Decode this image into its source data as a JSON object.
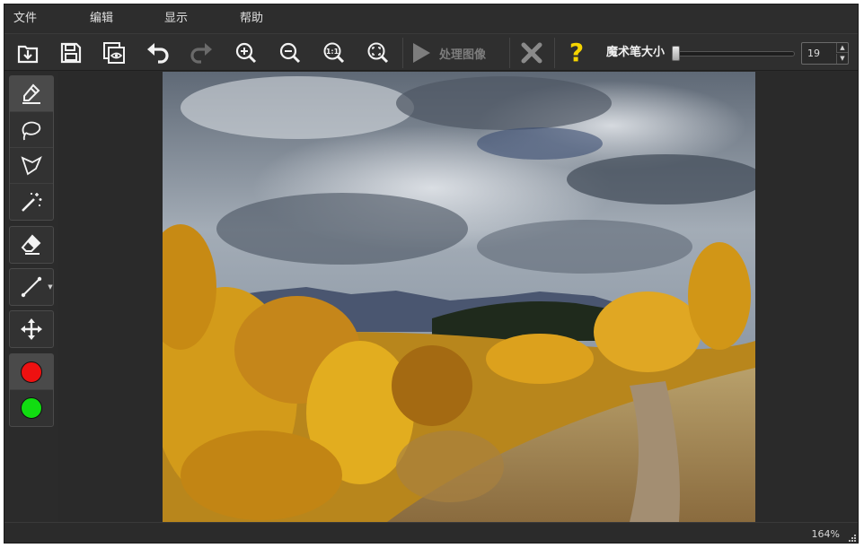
{
  "menu": {
    "items": [
      {
        "label": "文件"
      },
      {
        "label": "编辑"
      },
      {
        "label": "显示"
      },
      {
        "label": "帮助"
      }
    ]
  },
  "toolbar": {
    "buttons": [
      {
        "icon": "import-icon"
      },
      {
        "icon": "save-icon"
      },
      {
        "icon": "preview-icon"
      },
      {
        "icon": "undo-icon"
      },
      {
        "icon": "redo-icon"
      },
      {
        "icon": "zoom-in-icon"
      },
      {
        "icon": "zoom-out-icon"
      },
      {
        "icon": "actual-size-icon",
        "text": "1:1"
      },
      {
        "icon": "fit-to-window-icon"
      }
    ],
    "process_label": "处理图像",
    "help_glyph": "?",
    "brush_size_label": "魔术笔大小",
    "brush_size_value": "19"
  },
  "tools": [
    {
      "icon": "marker-icon",
      "active": true
    },
    {
      "icon": "lasso-icon"
    },
    {
      "icon": "polygon-lasso-icon"
    },
    {
      "icon": "magic-wand-icon"
    },
    {
      "icon": "eraser-icon"
    },
    {
      "icon": "line-icon"
    },
    {
      "icon": "move-icon"
    }
  ],
  "colors": {
    "keep": "#ee1111",
    "remove": "#11dd11",
    "help": "#f5d400",
    "process_disabled": "#7d7d7d",
    "remove_disabled": "#8a8a8a"
  },
  "status": {
    "zoom": "164%"
  }
}
